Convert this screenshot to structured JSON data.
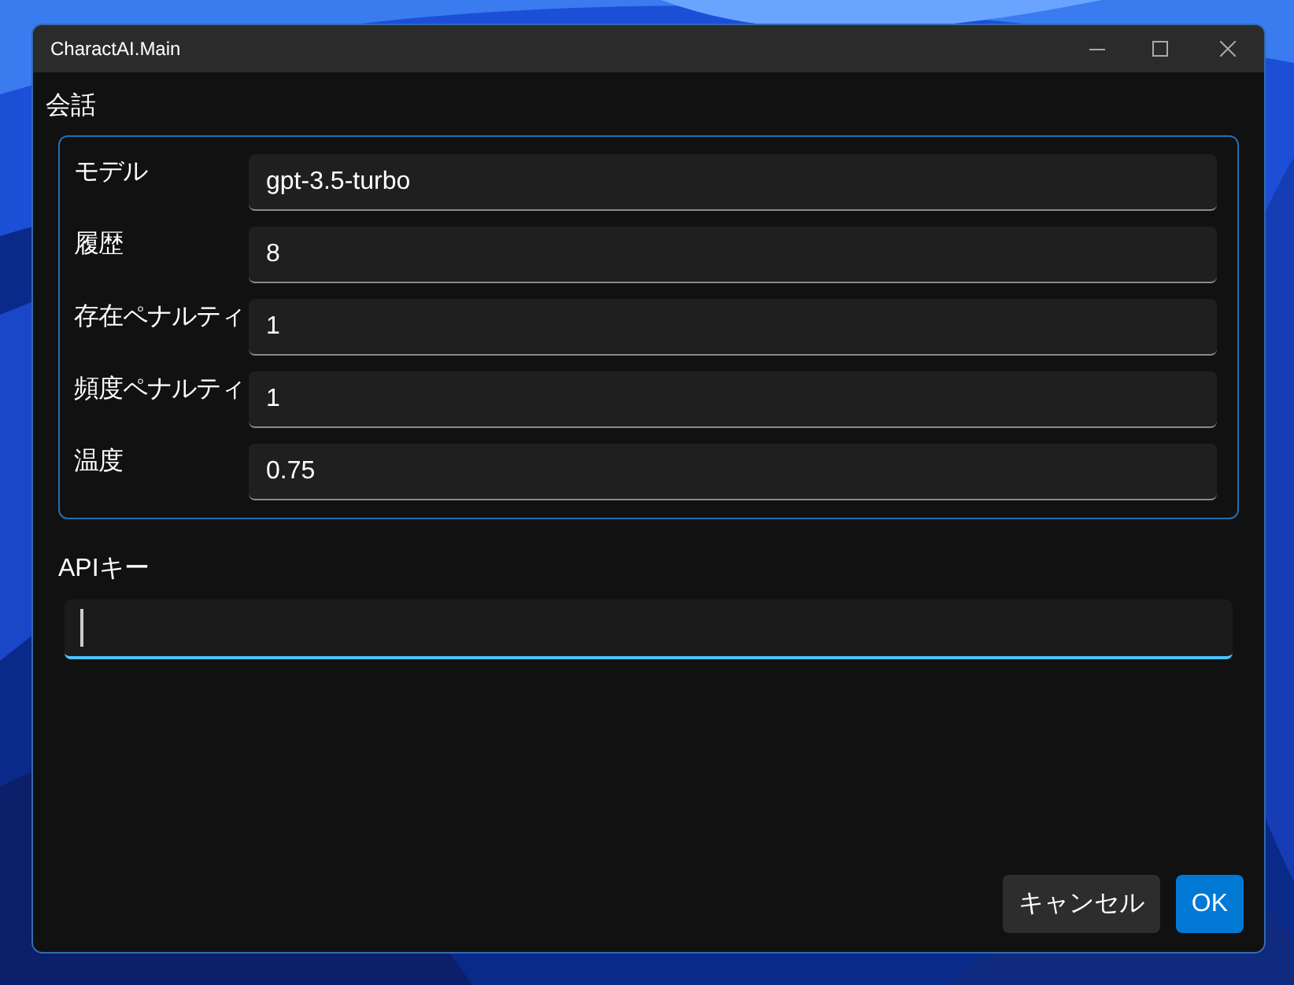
{
  "window": {
    "title": "CharactAI.Main"
  },
  "group": {
    "title": "会話",
    "fields": [
      {
        "label": "モデル",
        "value": "gpt-3.5-turbo"
      },
      {
        "label": "履歴",
        "value": "8"
      },
      {
        "label": "存在ペナルティ",
        "value": "1"
      },
      {
        "label": "頻度ペナルティ",
        "value": "1"
      },
      {
        "label": "温度",
        "value": "0.75"
      }
    ]
  },
  "api_key": {
    "label": "APIキー",
    "focused": true
  },
  "buttons": [
    {
      "label": "キャンセル",
      "kind": "secondary"
    },
    {
      "label": "OK",
      "kind": "primary"
    }
  ]
}
